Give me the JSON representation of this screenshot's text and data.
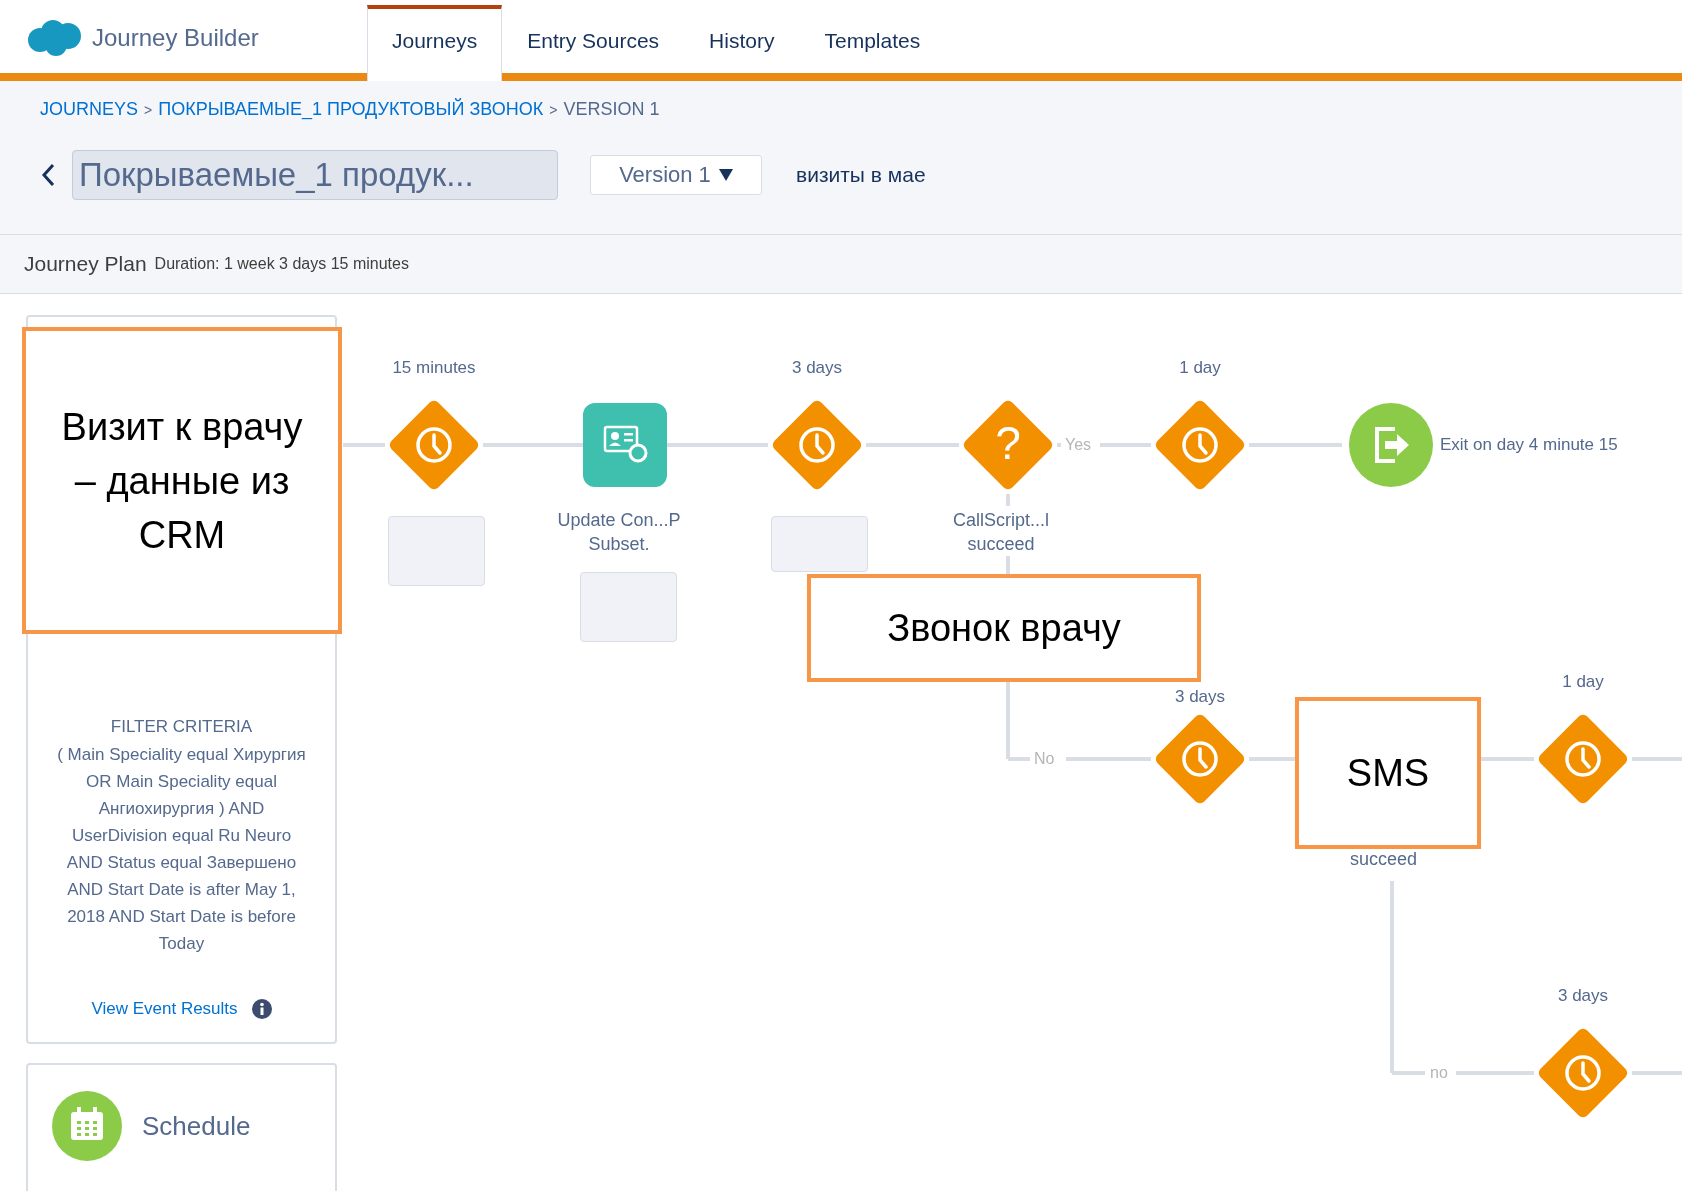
{
  "app": {
    "title": "Journey Builder"
  },
  "tabs": [
    {
      "label": "Journeys",
      "selected": true
    },
    {
      "label": "Entry Sources",
      "selected": false
    },
    {
      "label": "History",
      "selected": false
    },
    {
      "label": "Templates",
      "selected": false
    }
  ],
  "breadcrumb": [
    {
      "kind": "link",
      "text": "JOURNEYS"
    },
    {
      "kind": "separator",
      "text": ">"
    },
    {
      "kind": "link",
      "text": "ПОКРЫВАЕМЫЕ_1 ПРОДУКТОВЫЙ ЗВОНОК"
    },
    {
      "kind": "separator",
      "text": ">"
    },
    {
      "kind": "current",
      "text": "VERSION 1"
    }
  ],
  "journey": {
    "name": "Покрываемые_1 продук...",
    "version": "Version 1",
    "description": "визиты в мае"
  },
  "plan": {
    "title": "Journey Plan",
    "duration": "Duration: 1 week 3 days 15 minutes"
  },
  "entry_card": {
    "filter_title": "FILTER CRITERIA",
    "filter_text": "( Main Speciality equal Хирургия OR Main Speciality equal Ангиохирургия ) AND UserDivision equal Ru Neuro AND Status equal Завершено AND Start Date is after May 1, 2018 AND Start Date is before Today",
    "link": "View Event Results"
  },
  "schedule_card": {
    "label": "Schedule"
  },
  "nodes": [
    {
      "kind": "wait",
      "duration": "15 minutes"
    },
    {
      "kind": "activity",
      "caption": [
        "Update Con...P",
        "Subset."
      ]
    },
    {
      "kind": "wait",
      "duration": "3 days"
    },
    {
      "kind": "decision",
      "symbol": "?",
      "caption": [
        "CallScript...l",
        "succeed"
      ]
    },
    {
      "kind": "wait",
      "duration": "1 day"
    },
    {
      "kind": "exit",
      "caption": [
        "Exit on day 4 minute 15"
      ]
    },
    {
      "kind": "wait",
      "duration": "3 days"
    },
    {
      "kind": "wait",
      "duration": "1 day"
    },
    {
      "kind": "wait",
      "duration": "3 days"
    }
  ],
  "path_labels": [
    {
      "kind": "branch",
      "text": "Yes"
    },
    {
      "kind": "branch",
      "text": "No"
    },
    {
      "kind": "caption",
      "text": "succeed"
    },
    {
      "kind": "branch",
      "text": "no"
    }
  ],
  "annotations": [
    {
      "text": "Визит к врачу – данные из CRM"
    },
    {
      "text": "Звонок врачу"
    },
    {
      "text": "SMS"
    }
  ]
}
